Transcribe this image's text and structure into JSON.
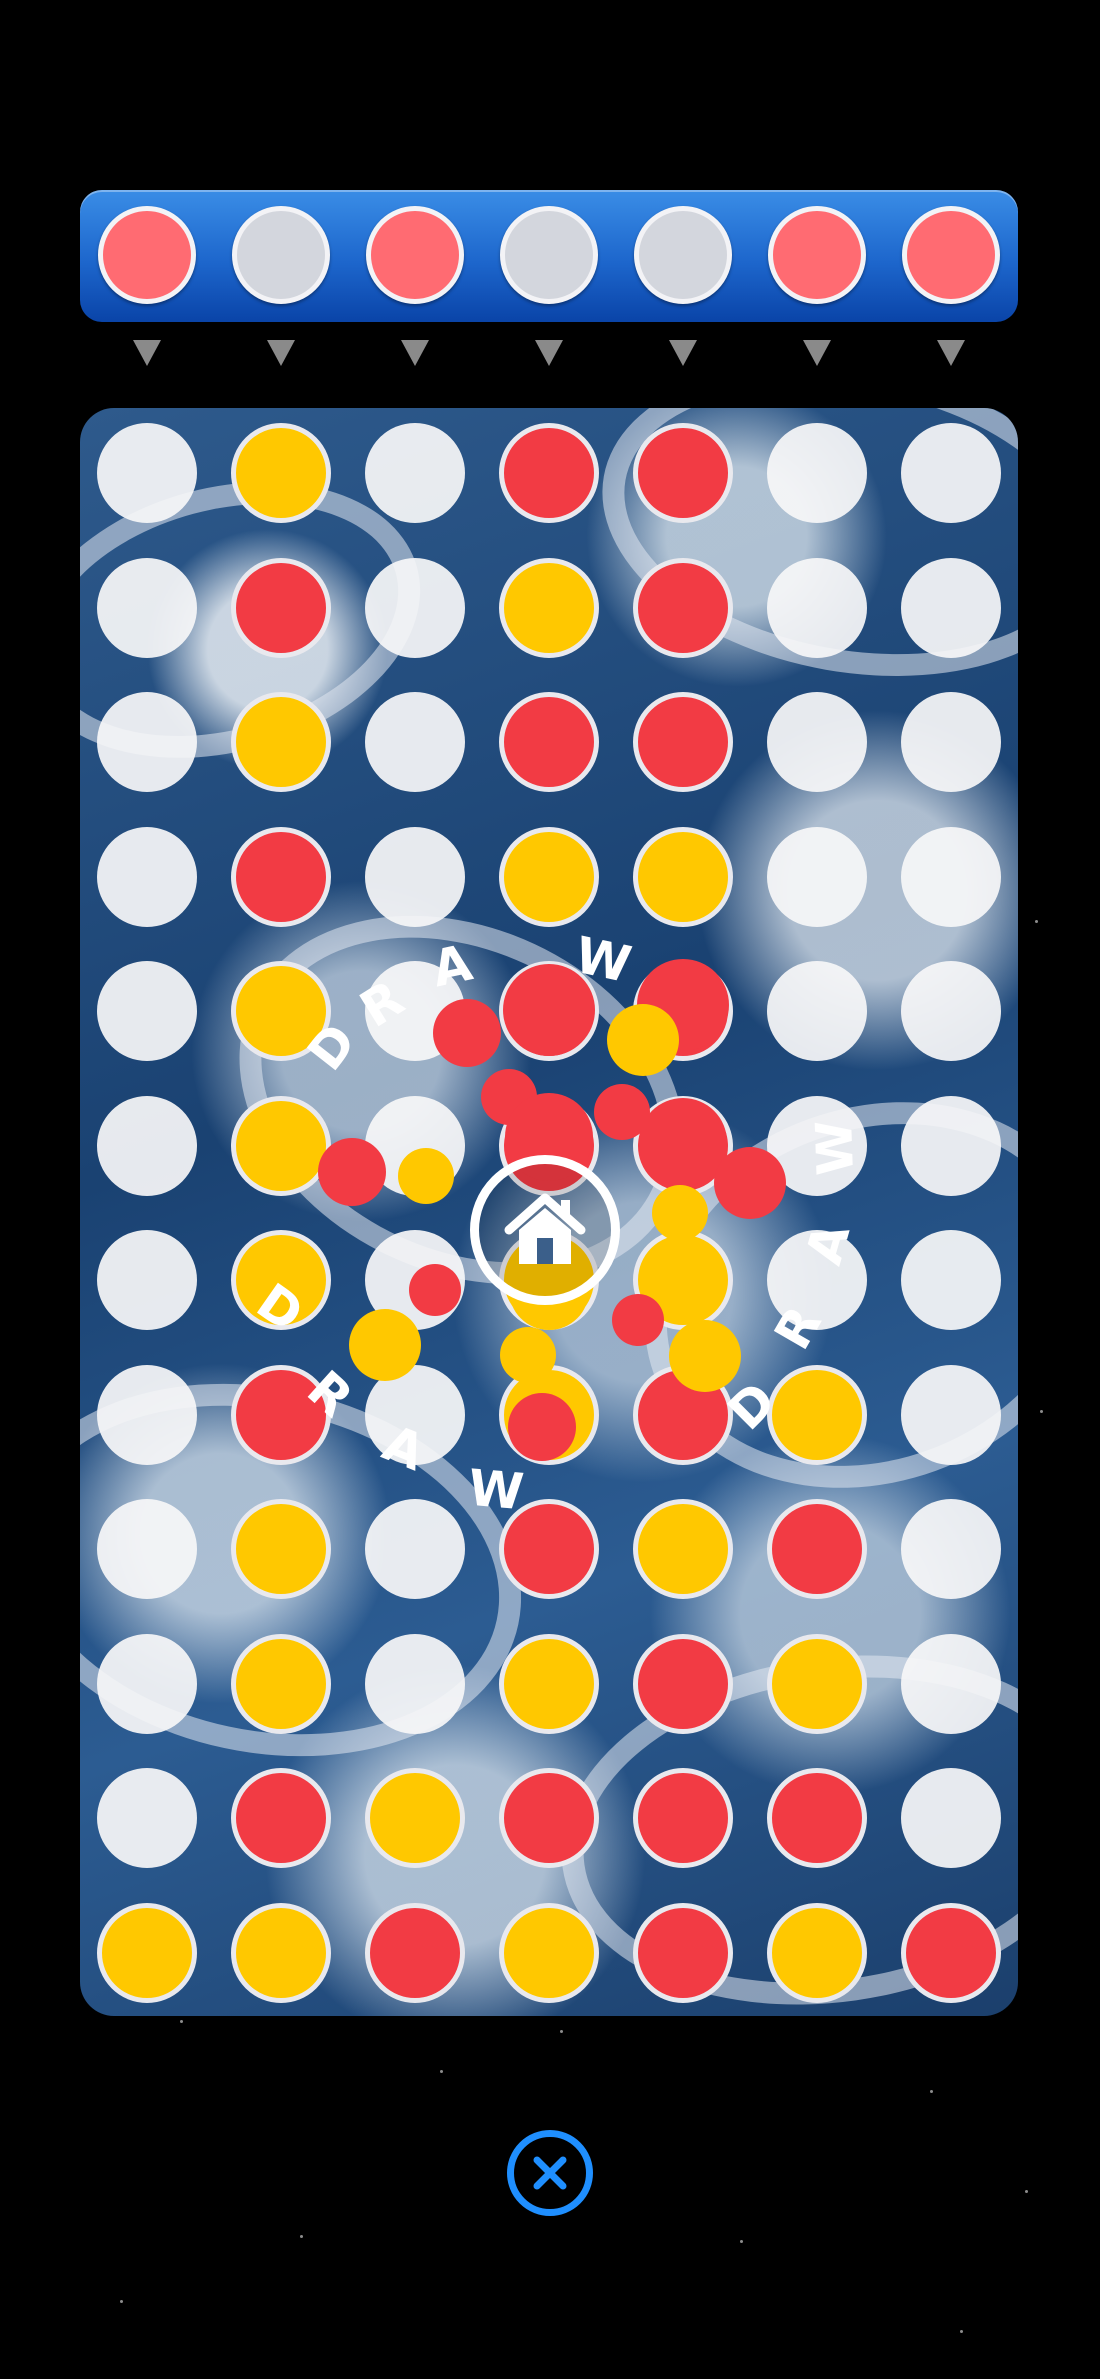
{
  "preview_row": [
    "red",
    "empty",
    "red",
    "empty",
    "empty",
    "red",
    "red"
  ],
  "board": {
    "rows": 12,
    "cols": 7,
    "cells": [
      [
        "empty",
        "yellow",
        "empty",
        "red",
        "red",
        "empty",
        "empty"
      ],
      [
        "empty",
        "red",
        "empty",
        "yellow",
        "red",
        "empty",
        "empty"
      ],
      [
        "empty",
        "yellow",
        "empty",
        "red",
        "red",
        "empty",
        "empty"
      ],
      [
        "empty",
        "red",
        "empty",
        "yellow",
        "yellow",
        "empty",
        "empty"
      ],
      [
        "empty",
        "yellow",
        "empty",
        "red",
        "red",
        "empty",
        "empty"
      ],
      [
        "empty",
        "yellow",
        "empty",
        "red",
        "red",
        "empty",
        "empty"
      ],
      [
        "empty",
        "yellow",
        "empty",
        "yellow",
        "yellow",
        "empty",
        "empty"
      ],
      [
        "empty",
        "red",
        "empty",
        "yellow",
        "red",
        "yellow",
        "empty"
      ],
      [
        "empty",
        "yellow",
        "empty",
        "red",
        "yellow",
        "red",
        "empty"
      ],
      [
        "empty",
        "yellow",
        "empty",
        "yellow",
        "red",
        "yellow",
        "empty"
      ],
      [
        "empty",
        "red",
        "yellow",
        "red",
        "red",
        "red",
        "empty"
      ],
      [
        "yellow",
        "yellow",
        "red",
        "yellow",
        "red",
        "yellow",
        "red"
      ]
    ]
  },
  "result_text": "DRAW",
  "colors": {
    "red": "#f23b44",
    "yellow": "#ffc800",
    "empty": "#f6f6f8",
    "top_bar": "#1d66cc",
    "close_accent": "#1f8fff"
  },
  "icons": {
    "home": "home-icon",
    "close": "close-icon",
    "column_arrow": "triangle-down-icon"
  }
}
